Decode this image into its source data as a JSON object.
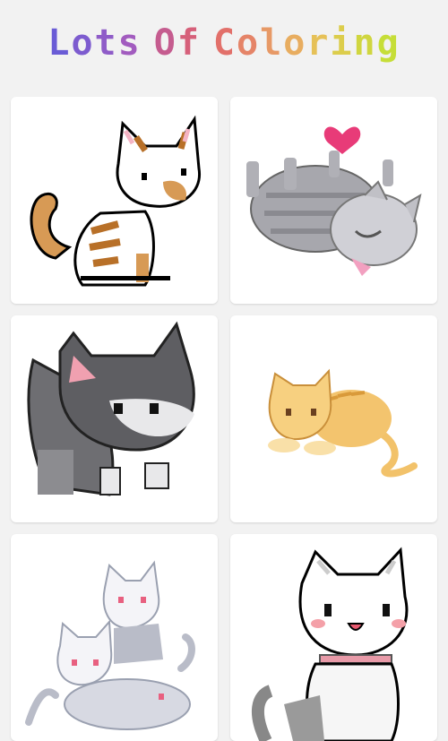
{
  "header": {
    "title": "Lots Of Coloring",
    "title_letters": [
      {
        "ch": "L",
        "color": "#6a5cd6"
      },
      {
        "ch": "o",
        "color": "#7d5ccf"
      },
      {
        "ch": "t",
        "color": "#8f5cc8"
      },
      {
        "ch": "s",
        "color": "#a25cbf"
      },
      {
        "ch": " ",
        "color": "#000000"
      },
      {
        "ch": "O",
        "color": "#c55c8f"
      },
      {
        "ch": "f",
        "color": "#d6607a"
      },
      {
        "ch": " ",
        "color": "#000000"
      },
      {
        "ch": "C",
        "color": "#e2706a"
      },
      {
        "ch": "o",
        "color": "#e58468"
      },
      {
        "ch": "l",
        "color": "#e79966"
      },
      {
        "ch": "o",
        "color": "#e8ad60"
      },
      {
        "ch": "r",
        "color": "#e6c158"
      },
      {
        "ch": "i",
        "color": "#dccd4c"
      },
      {
        "ch": "n",
        "color": "#d0d640"
      },
      {
        "ch": "g",
        "color": "#c6de38"
      }
    ]
  },
  "gallery": {
    "items": [
      {
        "name": "orange-striped-cat",
        "kind": "sitting"
      },
      {
        "name": "gray-cat-with-heart",
        "kind": "rolling"
      },
      {
        "name": "gray-white-kitten",
        "kind": "standing"
      },
      {
        "name": "orange-lying-cat",
        "kind": "lying"
      },
      {
        "name": "stacked-white-cats",
        "kind": "stack"
      },
      {
        "name": "white-cat-with-collar",
        "kind": "smiling"
      }
    ]
  }
}
